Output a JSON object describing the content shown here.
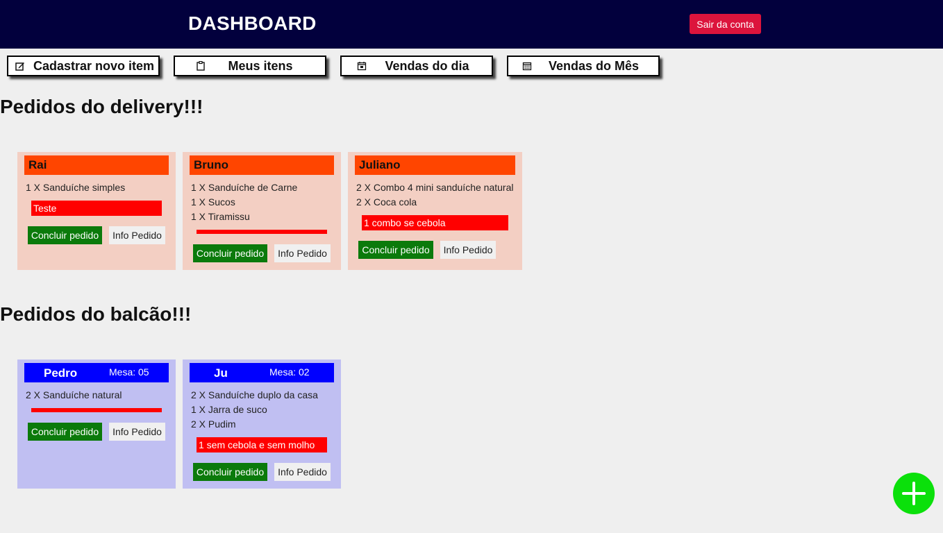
{
  "header": {
    "title": "DASHBOARD",
    "logout_label": "Sair da conta",
    "background": "#02003d"
  },
  "nav": [
    {
      "label": "Cadastrar novo item",
      "icon": "edit-icon"
    },
    {
      "label": "Meus itens",
      "icon": "clipboard-icon"
    },
    {
      "label": "Vendas do dia",
      "icon": "calendar-day-icon"
    },
    {
      "label": "Vendas do Mês",
      "icon": "calendar-month-icon"
    }
  ],
  "delivery": {
    "title": "Pedidos do delivery!!!",
    "orders": [
      {
        "name": "Rai",
        "items": [
          "1 X Sanduíche simples"
        ],
        "note": "Teste"
      },
      {
        "name": "Bruno",
        "items": [
          "1 X Sanduíche de Carne",
          "1 X Sucos",
          "1 X Tiramissu"
        ],
        "note": ""
      },
      {
        "name": "Juliano",
        "items": [
          "2 X Combo 4 mini sanduíche natural",
          "2 X Coca cola"
        ],
        "note": "1 combo se cebola"
      }
    ]
  },
  "counter": {
    "title": "Pedidos do balcão!!!",
    "orders": [
      {
        "name": "Pedro",
        "mesa": "Mesa: 05",
        "items": [
          "2 X Sanduíche natural"
        ],
        "note": ""
      },
      {
        "name": "Ju",
        "mesa": "Mesa: 02",
        "items": [
          "2 X Sanduíche duplo da casa",
          "1 X Jarra de suco",
          "2 X Pudim"
        ],
        "note": "1 sem cebola e sem molho"
      }
    ]
  },
  "buttons": {
    "done_label": "Concluir pedido",
    "info_label": "Info Pedido"
  },
  "colors": {
    "delivery_card": "#f3cfc3",
    "delivery_header": "#ff4500",
    "counter_card": "#c0bff2",
    "counter_header": "#0000ff",
    "note": "#ff0000",
    "done_button": "#0b7a0b",
    "fab": "#0be00b",
    "logout": "#dc143c"
  },
  "fab": {
    "icon": "plus-icon"
  }
}
